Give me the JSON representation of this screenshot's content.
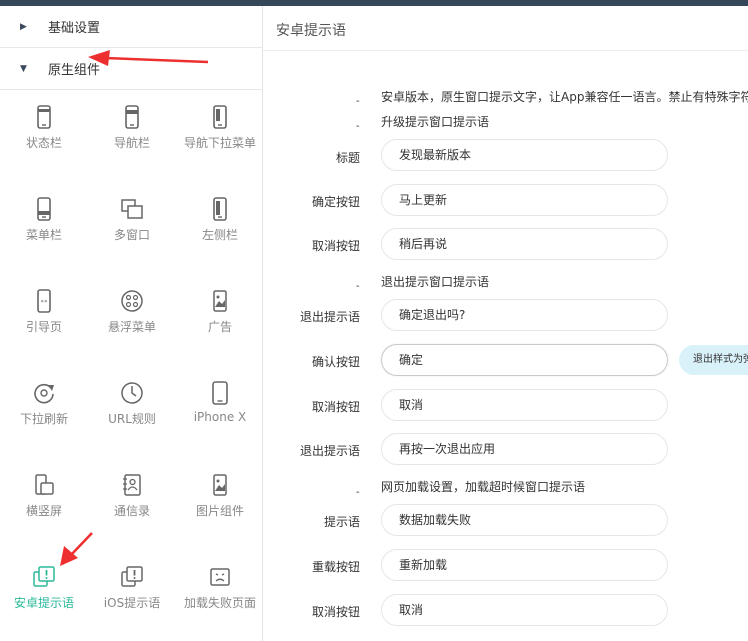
{
  "left": {
    "sections": [
      {
        "label": "基础设置"
      },
      {
        "label": "原生组件"
      }
    ],
    "grid": [
      {
        "label": "状态栏",
        "icon": "phone-statusbar-icon"
      },
      {
        "label": "导航栏",
        "icon": "phone-navbar-icon"
      },
      {
        "label": "导航下拉菜单",
        "icon": "phone-dropdown-icon"
      },
      {
        "label": "菜单栏",
        "icon": "phone-menubar-icon"
      },
      {
        "label": "多窗口",
        "icon": "multi-window-icon"
      },
      {
        "label": "左侧栏",
        "icon": "phone-sidebar-icon"
      },
      {
        "label": "引导页",
        "icon": "guide-page-icon"
      },
      {
        "label": "悬浮菜单",
        "icon": "float-menu-icon"
      },
      {
        "label": "广告",
        "icon": "ad-image-icon"
      },
      {
        "label": "下拉刷新",
        "icon": "pull-refresh-icon"
      },
      {
        "label": "URL规则",
        "icon": "clock-icon"
      },
      {
        "label": "iPhone X",
        "icon": "iphone-x-icon"
      },
      {
        "label": "横竖屏",
        "icon": "rotate-screen-icon"
      },
      {
        "label": "通信录",
        "icon": "contacts-icon"
      },
      {
        "label": "图片组件",
        "icon": "image-component-icon"
      },
      {
        "label": "安卓提示语",
        "icon": "android-tip-icon"
      },
      {
        "label": "iOS提示语",
        "icon": "ios-tip-icon"
      },
      {
        "label": "加载失败页面",
        "icon": "sad-face-icon"
      }
    ]
  },
  "right": {
    "title": "安卓提示语",
    "intro": "安卓版本，原生窗口提示文字，让App兼容任一语言。禁止有特殊字符和",
    "group1": "升级提示窗口提示语",
    "group2": "退出提示窗口提示语",
    "group3": "网页加载设置，加载超时候窗口提示语",
    "fields": [
      {
        "label": "标题",
        "value": "发现最新版本"
      },
      {
        "label": "确定按钮",
        "value": "马上更新"
      },
      {
        "label": "取消按钮",
        "value": "稍后再说"
      },
      {
        "label": "退出提示语",
        "value": "确定退出吗?"
      },
      {
        "label": "确认按钮",
        "value": "确定"
      },
      {
        "label": "取消按钮",
        "value": "取消"
      },
      {
        "label": "退出提示语",
        "value": "再按一次退出应用"
      },
      {
        "label": "提示语",
        "value": "数据加载失败"
      },
      {
        "label": "重载按钮",
        "value": "重新加载"
      },
      {
        "label": "取消按钮",
        "value": "取消"
      }
    ],
    "tooltip": "退出样式为弹"
  },
  "colors": {
    "active": "#2bb89a",
    "arrow": "#ee2f2f",
    "topbar": "#37475a"
  }
}
